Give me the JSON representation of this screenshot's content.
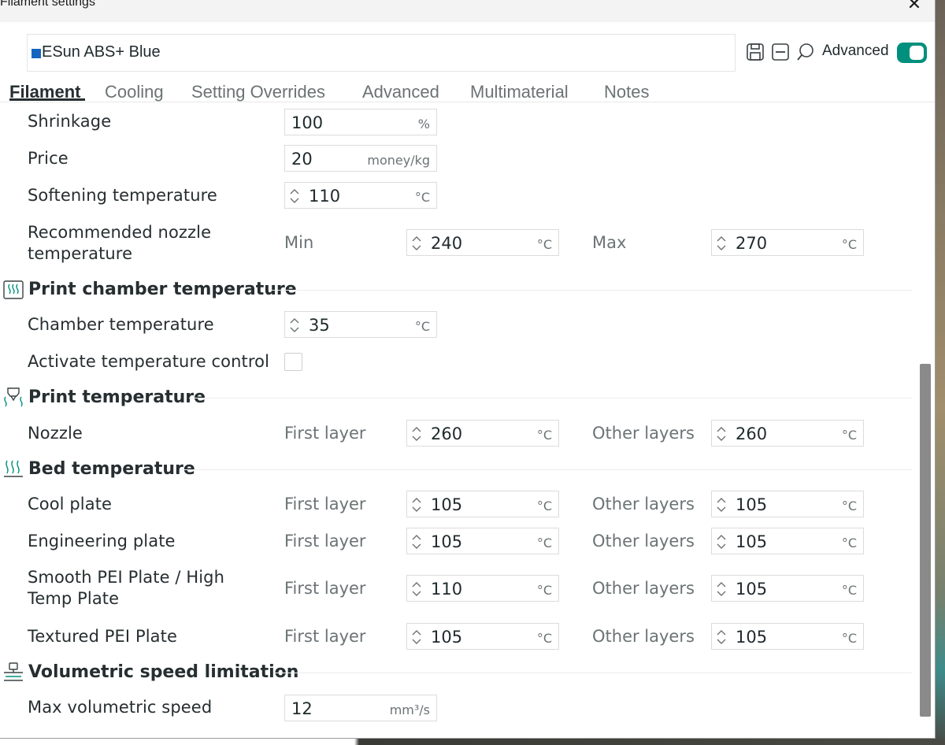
{
  "window": {
    "title": "Filament settings",
    "close_glyph": "✕"
  },
  "preset": {
    "name": "ESun ABS+ Blue",
    "color": "#1565c0"
  },
  "toolbar": {
    "advanced_label": "Advanced",
    "advanced_on": true,
    "accent_color": "#00907d",
    "icons": [
      "save-icon",
      "delete-icon",
      "search-icon"
    ]
  },
  "tabs": [
    {
      "label": "Filament",
      "active": true
    },
    {
      "label": "Cooling"
    },
    {
      "label": "Setting Overrides"
    },
    {
      "label": "Advanced"
    },
    {
      "label": "Multimaterial"
    },
    {
      "label": "Notes"
    }
  ],
  "rows": {
    "shrinkage": {
      "label": "Shrinkage",
      "value": "100",
      "unit": "%"
    },
    "price": {
      "label": "Price",
      "value": "20",
      "unit": "money/kg"
    },
    "softening": {
      "label": "Softening temperature",
      "value": "110",
      "unit": "°C"
    },
    "nozzle_range": {
      "label": "Recommended nozzle temperature",
      "min_label": "Min",
      "min_value": "240",
      "min_unit": "°C",
      "max_label": "Max",
      "max_value": "270",
      "max_unit": "°C"
    }
  },
  "sections": {
    "chamber": {
      "title": "Print chamber temperature",
      "icon": "chamber-heat-icon",
      "chamber_temp": {
        "label": "Chamber temperature",
        "value": "35",
        "unit": "°C"
      },
      "activate": {
        "label": "Activate temperature control",
        "checked": false
      }
    },
    "print_temp": {
      "title": "Print temperature",
      "icon": "nozzle-heat-icon",
      "nozzle": {
        "label": "Nozzle",
        "first_label": "First layer",
        "first_value": "260",
        "other_label": "Other layers",
        "other_value": "260",
        "unit": "°C"
      }
    },
    "bed_temp": {
      "title": "Bed temperature",
      "icon": "bed-heat-icon",
      "plates": [
        {
          "label": "Cool plate",
          "first_label": "First layer",
          "first_value": "105",
          "other_label": "Other layers",
          "other_value": "105",
          "unit": "°C"
        },
        {
          "label": "Engineering plate",
          "first_label": "First layer",
          "first_value": "105",
          "other_label": "Other layers",
          "other_value": "105",
          "unit": "°C"
        },
        {
          "label": "Smooth PEI Plate / High Temp Plate",
          "first_label": "First layer",
          "first_value": "110",
          "other_label": "Other layers",
          "other_value": "105",
          "unit": "°C"
        },
        {
          "label": "Textured PEI Plate",
          "first_label": "First layer",
          "first_value": "105",
          "other_label": "Other layers",
          "other_value": "105",
          "unit": "°C"
        }
      ]
    },
    "volumetric": {
      "title": "Volumetric speed limitation",
      "icon": "volumetric-speed-icon",
      "max_speed": {
        "label": "Max volumetric speed",
        "value": "12",
        "unit": "mm³/s"
      }
    }
  }
}
